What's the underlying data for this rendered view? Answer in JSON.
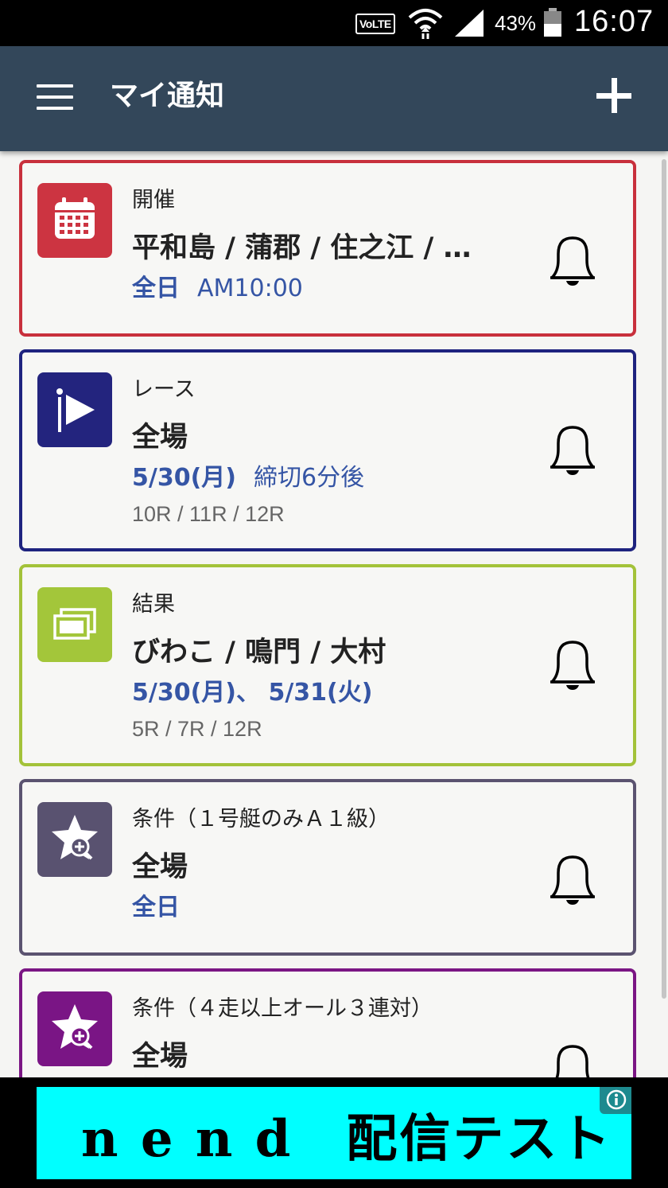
{
  "status_bar": {
    "volte": "VoLTE",
    "battery_percent": "43%",
    "time": "16:07"
  },
  "app_bar": {
    "title": "マイ通知",
    "menu_icon": "hamburger-menu-icon",
    "add_icon": "plus-icon"
  },
  "notifications": [
    {
      "category": "開催",
      "venues": "平和島 / 蒲郡 / 住之江 / …",
      "date_bold": "全日",
      "date_extra": "AM10:00",
      "races": "",
      "border_color": "#c8303c",
      "icon": "calendar-icon",
      "icon_bg": "#cc3441"
    },
    {
      "category": "レース",
      "venues": "全場",
      "date_bold": "5/30(月)",
      "date_extra": "締切6分後",
      "races": "10R / 11R / 12R",
      "border_color": "#1e237f",
      "icon": "race-start-flag-icon",
      "icon_bg": "#23247e"
    },
    {
      "category": "結果",
      "venues": "びわこ / 鳴門 / 大村",
      "date_bold": "5/30(月)、 5/31(火)",
      "date_extra": "",
      "races": "5R / 7R / 12R",
      "border_color": "#a3c239",
      "icon": "result-cards-icon",
      "icon_bg": "#a3c63a"
    },
    {
      "category": "条件（１号艇のみＡ１級）",
      "venues": "全場",
      "date_bold": "全日",
      "date_extra": "",
      "races": "",
      "border_color": "#5b5370",
      "icon": "star-condition-icon",
      "icon_bg": "#595270"
    },
    {
      "category": "条件（４走以上オール３連対）",
      "venues": "全場",
      "date_bold": "",
      "date_extra": "",
      "races": "",
      "border_color": "#7b1684",
      "icon": "star-condition-icon",
      "icon_bg": "#7a1585"
    }
  ],
  "ad": {
    "text": "n e n d　配信テスト",
    "info_icon": "info-icon"
  }
}
